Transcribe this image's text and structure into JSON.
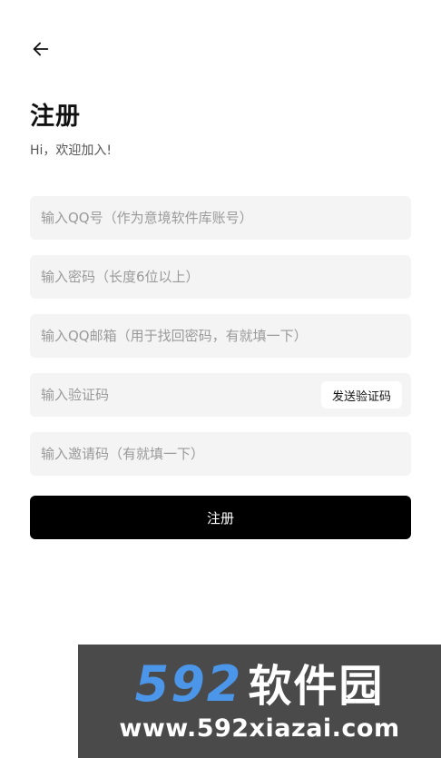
{
  "header": {
    "back_icon": "arrow-left-icon",
    "title": "注册",
    "subtitle": "Hi，欢迎加入!"
  },
  "form": {
    "qq_placeholder": "输入QQ号（作为意境软件库账号）",
    "password_placeholder": "输入密码（长度6位以上）",
    "email_placeholder": "输入QQ邮箱（用于找回密码，有就填一下）",
    "code_placeholder": "输入验证码",
    "send_code_label": "发送验证码",
    "invite_placeholder": "输入邀请码（有就填一下）",
    "submit_label": "注册"
  },
  "watermark": {
    "number": "592",
    "name": "软件园",
    "url": "www.592xiazai.com"
  },
  "colors": {
    "field_bg": "#f4f4f4",
    "button_bg": "#000000",
    "watermark_blue": "#4b96e8"
  }
}
